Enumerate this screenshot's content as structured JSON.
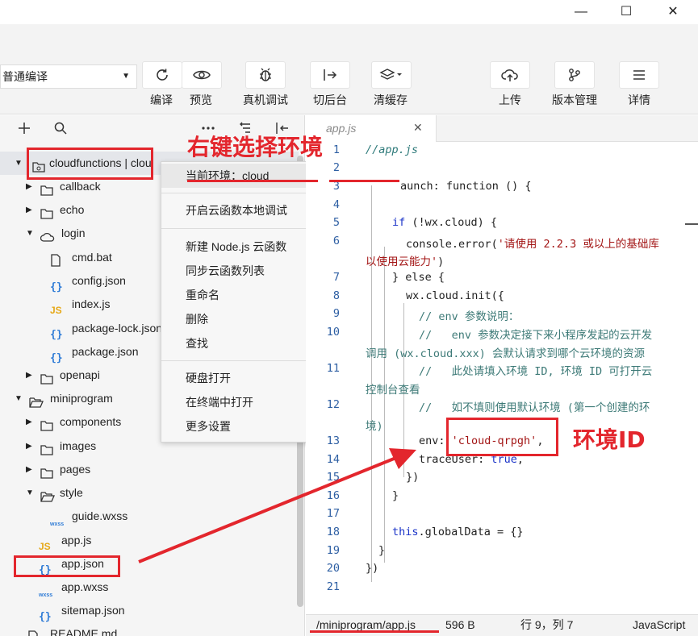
{
  "titlebar": {
    "minimize_label": "—",
    "maximize_label": "☐",
    "close_label": "✕"
  },
  "toolbar": {
    "compile_mode": "普通编译",
    "buttons": [
      {
        "label": "编译",
        "icon": "refresh-icon"
      },
      {
        "label": "预览",
        "icon": "eye-icon"
      },
      {
        "label": "真机调试",
        "icon": "bug-icon"
      },
      {
        "label": "切后台",
        "icon": "switch-background-icon"
      },
      {
        "label": "清缓存",
        "icon": "layers-icon"
      },
      {
        "label": "上传",
        "icon": "cloud-upload-icon"
      },
      {
        "label": "版本管理",
        "icon": "version-icon"
      },
      {
        "label": "详情",
        "icon": "menu-icon"
      }
    ]
  },
  "explorer": {
    "tree": [
      {
        "label": "cloudfunctions | clou",
        "icon": "cloud-folder-icon",
        "expanded": true
      },
      {
        "label": "callback",
        "icon": "folder-icon"
      },
      {
        "label": "echo",
        "icon": "folder-icon"
      },
      {
        "label": "login",
        "icon": "cloud-icon",
        "expanded": true
      },
      {
        "label": "cmd.bat",
        "icon": "file-icon"
      },
      {
        "label": "config.json",
        "icon": "json-icon"
      },
      {
        "label": "index.js",
        "icon": "js-icon"
      },
      {
        "label": "package-lock.json",
        "icon": "json-icon"
      },
      {
        "label": "package.json",
        "icon": "json-icon"
      },
      {
        "label": "openapi",
        "icon": "folder-icon"
      },
      {
        "label": "miniprogram",
        "icon": "folder-open-icon",
        "expanded": true
      },
      {
        "label": "components",
        "icon": "folder-icon"
      },
      {
        "label": "images",
        "icon": "folder-icon"
      },
      {
        "label": "pages",
        "icon": "folder-icon"
      },
      {
        "label": "style",
        "icon": "folder-open-icon",
        "expanded": true
      },
      {
        "label": "guide.wxss",
        "icon": "wxss-icon"
      },
      {
        "label": "app.js",
        "icon": "js-icon"
      },
      {
        "label": "app.json",
        "icon": "json-icon"
      },
      {
        "label": "app.wxss",
        "icon": "wxss-icon"
      },
      {
        "label": "sitemap.json",
        "icon": "json-icon"
      },
      {
        "label": "README.md",
        "icon": "file-icon"
      }
    ]
  },
  "context_menu": {
    "items": [
      "当前环境：cloud",
      "开启云函数本地调试",
      "新建 Node.js 云函数",
      "同步云函数列表",
      "重命名",
      "删除",
      "查找",
      "硬盘打开",
      "在终端中打开",
      "更多设置"
    ],
    "submenu_item": "cloud"
  },
  "editor": {
    "tab_label": "app.js",
    "line_numbers": [
      "1",
      "2",
      "3",
      "4",
      "5",
      "6",
      "7",
      "8",
      "9",
      "10",
      "11",
      "12",
      "13",
      "14",
      "15",
      "16",
      "17",
      "18",
      "19",
      "20",
      "21"
    ],
    "code": {
      "l1": "//app.js",
      "l3": "aunch: function () {",
      "l5_if": "if",
      "l5_rest": " (!wx.cloud) {",
      "l6_a": "console.error(",
      "l6_b": "'请使用 2.2.3 或以上的基础库",
      "l6_c": "以使用云能力'",
      "l6_d": ")",
      "l7": "} else {",
      "l8": "wx.cloud.init({",
      "l9": "// env 参数说明：",
      "l10_a": "//   env 参数决定接下来小程序发起的云开发",
      "l10_b": "调用 (wx.cloud.xxx) 会默认请求到哪个云环境的资源",
      "l11_a": "//   此处请填入环境 ID, 环境 ID 可打开云",
      "l11_b": "控制台查看",
      "l12_a": "//   如不填则使用默认环境 (第一个创建的环",
      "l12_b": "境)",
      "l13_a": "env: ",
      "l13_b": "'cloud-qrpgh'",
      "l13_c": ",",
      "l14_a": "traceUser: ",
      "l14_b": "true",
      "l14_c": ",",
      "l15": "})",
      "l16": "}",
      "l18_a": "this",
      "l18_b": ".globalData = {}",
      "l19": "}",
      "l20": "})"
    }
  },
  "status": {
    "path": "/miniprogram/app.js",
    "size": "596 B",
    "position": "行 9，列 7",
    "language": "JavaScript"
  },
  "annotations": {
    "right_click": "右键选择环境",
    "env_id": "环境ID"
  },
  "colors": {
    "annotation_red": "#e3262d",
    "keyword_blue": "#1a33c8",
    "string_red": "#a31515"
  }
}
